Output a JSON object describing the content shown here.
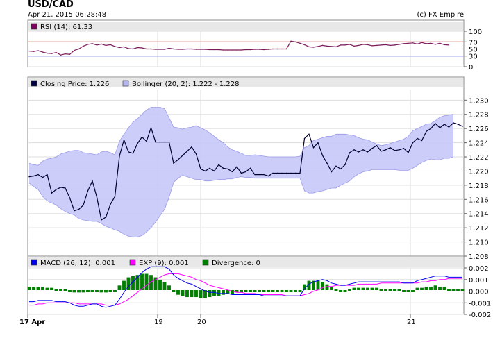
{
  "header": {
    "symbol": "USD/CAD",
    "timestamp": "Apr 21, 2015 06:28:48",
    "copyright": "(c) FX Empire"
  },
  "colors": {
    "price": "#000033",
    "bollinger_fill": "#c8c8f8",
    "bollinger_edge": "#9a9ae8",
    "rsi": "#7a1a5a",
    "rsi_70": "#e06060",
    "rsi_30": "#6060e0",
    "macd": "#0000ee",
    "exp": "#ff00ff",
    "divergence": "#008000",
    "legend_bg": "#e8e8e8",
    "grid": "#dddddd"
  },
  "x_axis": {
    "labels": [
      "17 Apr",
      "19",
      "20",
      "21"
    ]
  },
  "chart_data": [
    {
      "type": "line",
      "panel": "rsi",
      "legend": [
        {
          "label": "RSI (14): 61.33",
          "color": "#800060"
        }
      ],
      "ylim": [
        0,
        100
      ],
      "ticks": [
        "100",
        "70",
        "50",
        "30",
        "0"
      ],
      "levels": [
        70,
        30
      ],
      "series": [
        {
          "name": "RSI (14)",
          "values": [
            44,
            43,
            45,
            41,
            38,
            37,
            40,
            33,
            36,
            35,
            46,
            50,
            58,
            63,
            65,
            61,
            64,
            60,
            62,
            57,
            54,
            56,
            51,
            50,
            54,
            53,
            50,
            50,
            49,
            49,
            49,
            52,
            50,
            49,
            49,
            50,
            50,
            49,
            49,
            49,
            48,
            48,
            48,
            47,
            47,
            47,
            47,
            47,
            48,
            48,
            49,
            49,
            48,
            49,
            50,
            50,
            50,
            50,
            72,
            70,
            66,
            62,
            56,
            55,
            57,
            60,
            58,
            57,
            56,
            61,
            61,
            63,
            58,
            60,
            63,
            62,
            59,
            60,
            61,
            62,
            60,
            61,
            63,
            65,
            66,
            67,
            64,
            68,
            65,
            66,
            63,
            66,
            62,
            61
          ]
        }
      ]
    },
    {
      "type": "line",
      "panel": "price",
      "legend": [
        {
          "label": "Closing Price: 1.226",
          "color": "#000040"
        },
        {
          "label": "Bollinger (20, 2): 1.222 - 1.228",
          "color": "#b4b4f0"
        }
      ],
      "ylim": [
        1.208,
        1.2315
      ],
      "ticks": [
        "1.230",
        "1.228",
        "1.226",
        "1.224",
        "1.222",
        "1.220",
        "1.218",
        "1.216",
        "1.214",
        "1.212",
        "1.210",
        "1.208"
      ],
      "series": [
        {
          "name": "Closing Price",
          "values": [
            1.2192,
            1.2193,
            1.2195,
            1.2191,
            1.2195,
            1.2169,
            1.2174,
            1.2177,
            1.2176,
            1.2162,
            1.2144,
            1.2146,
            1.2152,
            1.2172,
            1.2186,
            1.2163,
            1.2131,
            1.2135,
            1.2153,
            1.2164,
            1.2221,
            1.2244,
            1.2227,
            1.2225,
            1.2239,
            1.2248,
            1.2242,
            1.2261,
            1.2241,
            1.2241,
            1.2241,
            1.2241,
            1.2211,
            1.2216,
            1.2222,
            1.2228,
            1.2234,
            1.2224,
            1.2203,
            1.22,
            1.2204,
            1.22,
            1.2209,
            1.2204,
            1.2203,
            1.2199,
            1.2206,
            1.2197,
            1.2199,
            1.2204,
            1.2195,
            1.2195,
            1.2195,
            1.2193,
            1.2197,
            1.2197,
            1.2197,
            1.2197,
            1.2197,
            1.2197,
            1.2197,
            1.2246,
            1.2252,
            1.2233,
            1.224,
            1.2222,
            1.2211,
            1.2199,
            1.2207,
            1.2203,
            1.2209,
            1.2226,
            1.223,
            1.2227,
            1.223,
            1.2227,
            1.2232,
            1.2236,
            1.2228,
            1.223,
            1.2233,
            1.2229,
            1.223,
            1.2232,
            1.2226,
            1.224,
            1.2246,
            1.2243,
            1.2256,
            1.226,
            1.2267,
            1.2261,
            1.2266,
            1.2262,
            1.2268,
            1.2266,
            1.2263
          ]
        },
        {
          "name": "Bollinger Upper",
          "values": [
            1.2211,
            1.2209,
            1.2208,
            1.2214,
            1.2217,
            1.2218,
            1.222,
            1.2224,
            1.2226,
            1.2228,
            1.2229,
            1.2229,
            1.2226,
            1.2225,
            1.2224,
            1.2223,
            1.2227,
            1.2228,
            1.2226,
            1.2223,
            1.2242,
            1.2252,
            1.2261,
            1.2269,
            1.2274,
            1.228,
            1.2286,
            1.229,
            1.229,
            1.229,
            1.2288,
            1.2275,
            1.2262,
            1.2261,
            1.2259,
            1.2261,
            1.2262,
            1.2264,
            1.2261,
            1.2258,
            1.2254,
            1.2249,
            1.2244,
            1.224,
            1.2234,
            1.223,
            1.2228,
            1.2225,
            1.2222,
            1.2222,
            1.2223,
            1.2222,
            1.2221,
            1.222,
            1.222,
            1.222,
            1.222,
            1.222,
            1.222,
            1.222,
            1.2221,
            1.2233,
            1.2236,
            1.2243,
            1.2245,
            1.2247,
            1.2249,
            1.2249,
            1.2252,
            1.2252,
            1.2252,
            1.2251,
            1.225,
            1.2247,
            1.2245,
            1.2244,
            1.2241,
            1.2238,
            1.2236,
            1.2237,
            1.2239,
            1.2241,
            1.2243,
            1.2245,
            1.2249,
            1.2257,
            1.226,
            1.2263,
            1.2266,
            1.2267,
            1.2271,
            1.2276,
            1.2278,
            1.2279,
            1.228
          ]
        },
        {
          "name": "Bollinger Lower",
          "values": [
            1.2183,
            1.2178,
            1.2174,
            1.2164,
            1.2158,
            1.2155,
            1.2152,
            1.2147,
            1.2143,
            1.214,
            1.2138,
            1.2133,
            1.2131,
            1.213,
            1.2129,
            1.2129,
            1.2126,
            1.2122,
            1.212,
            1.2117,
            1.2115,
            1.2111,
            1.2108,
            1.2107,
            1.2107,
            1.2109,
            1.2114,
            1.212,
            1.2128,
            1.2137,
            1.2146,
            1.2163,
            1.2184,
            1.219,
            1.2194,
            1.2192,
            1.219,
            1.2188,
            1.2188,
            1.2186,
            1.2186,
            1.2187,
            1.2188,
            1.2188,
            1.2189,
            1.2189,
            1.2191,
            1.2192,
            1.2191,
            1.2191,
            1.219,
            1.219,
            1.219,
            1.219,
            1.219,
            1.219,
            1.219,
            1.219,
            1.219,
            1.219,
            1.219,
            1.2172,
            1.2169,
            1.2169,
            1.2171,
            1.2172,
            1.2174,
            1.2176,
            1.2176,
            1.218,
            1.2183,
            1.2186,
            1.2192,
            1.2196,
            1.2199,
            1.22,
            1.2202,
            1.2202,
            1.2202,
            1.2202,
            1.2202,
            1.2202,
            1.2201,
            1.2201,
            1.2201,
            1.2204,
            1.2208,
            1.2212,
            1.2215,
            1.2217,
            1.2216,
            1.2216,
            1.2218,
            1.2218,
            1.222
          ]
        }
      ]
    },
    {
      "type": "bar",
      "panel": "macd",
      "legend": [
        {
          "label": "MACD (26, 12): 0.001",
          "color": "#0000ee"
        },
        {
          "label": "EXP (9): 0.001",
          "color": "#ff00ff"
        },
        {
          "label": "Divergence: 0",
          "color": "#008000"
        }
      ],
      "ylim": [
        -0.002,
        0.002
      ],
      "ticks": [
        "0.002",
        "0.001",
        "0.000",
        "-0.001",
        "-0.002"
      ],
      "series": [
        {
          "name": "MACD",
          "values": [
            -0.0009,
            -0.0009,
            -0.0008,
            -0.0008,
            -0.0008,
            -0.0008,
            -0.0009,
            -0.0009,
            -0.0009,
            -0.001,
            -0.0012,
            -0.0013,
            -0.0013,
            -0.0012,
            -0.0011,
            -0.0011,
            -0.0013,
            -0.0014,
            -0.0013,
            -0.0012,
            -0.0007,
            -0.0001,
            0.0004,
            0.0008,
            0.0012,
            0.0016,
            0.0019,
            0.0021,
            0.0021,
            0.0021,
            0.0021,
            0.0019,
            0.0014,
            0.0011,
            0.0009,
            0.0007,
            0.0006,
            0.0004,
            0.0002,
            0.0,
            -0.0001,
            -0.0001,
            -0.0002,
            -0.0002,
            -0.0002,
            -0.0003,
            -0.0003,
            -0.0003,
            -0.0003,
            -0.0003,
            -0.0003,
            -0.0003,
            -0.0004,
            -0.0004,
            -0.0004,
            -0.0004,
            -0.0004,
            -0.0004,
            -0.0004,
            -0.0004,
            -0.0004,
            0.0002,
            0.0006,
            0.0008,
            0.0009,
            0.001,
            0.0009,
            0.0007,
            0.0006,
            0.0005,
            0.0005,
            0.0006,
            0.0007,
            0.0008,
            0.0008,
            0.0008,
            0.0008,
            0.0008,
            0.0008,
            0.0008,
            0.0008,
            0.0008,
            0.0008,
            0.0007,
            0.0007,
            0.0007,
            0.0009,
            0.001,
            0.0011,
            0.0012,
            0.0013,
            0.0013,
            0.0013,
            0.0012,
            0.0012,
            0.0012,
            0.0012
          ]
        },
        {
          "name": "EXP",
          "values": [
            -0.0012,
            -0.0012,
            -0.0011,
            -0.0011,
            -0.001,
            -0.001,
            -0.001,
            -0.001,
            -0.001,
            -0.001,
            -0.001,
            -0.0011,
            -0.0011,
            -0.0011,
            -0.0011,
            -0.0011,
            -0.0011,
            -0.0012,
            -0.0012,
            -0.0012,
            -0.0011,
            -0.0009,
            -0.0007,
            -0.0004,
            -0.0001,
            0.0002,
            0.0005,
            0.0008,
            0.001,
            0.0012,
            0.0014,
            0.0015,
            0.0015,
            0.0015,
            0.0014,
            0.0013,
            0.0012,
            0.001,
            0.0009,
            0.0007,
            0.0005,
            0.0004,
            0.0003,
            0.0002,
            0.0001,
            0.0,
            -0.0001,
            -0.0001,
            -0.0002,
            -0.0002,
            -0.0002,
            -0.0003,
            -0.0003,
            -0.0003,
            -0.0003,
            -0.0003,
            -0.0003,
            -0.0004,
            -0.0004,
            -0.0004,
            -0.0004,
            -0.0003,
            -0.0002,
            0.0,
            0.0001,
            0.0003,
            0.0004,
            0.0004,
            0.0005,
            0.0005,
            0.0005,
            0.0005,
            0.0005,
            0.0006,
            0.0006,
            0.0006,
            0.0006,
            0.0006,
            0.0007,
            0.0007,
            0.0007,
            0.0007,
            0.0007,
            0.0007,
            0.0007,
            0.0007,
            0.0007,
            0.0008,
            0.0008,
            0.0009,
            0.0009,
            0.001,
            0.001,
            0.0011,
            0.0011,
            0.0011,
            0.0011
          ]
        },
        {
          "name": "Divergence",
          "values": [
            0.0003,
            0.0003,
            0.0003,
            0.0003,
            0.0002,
            0.0002,
            0.0001,
            0.0001,
            0.0001,
            0.0,
            -0.0002,
            -0.0002,
            -0.0002,
            -0.0001,
            0.0,
            0.0,
            -0.0002,
            -0.0002,
            -0.0001,
            0.0,
            0.0004,
            0.0008,
            0.0011,
            0.0012,
            0.0013,
            0.0014,
            0.0014,
            0.0013,
            0.0011,
            0.0009,
            0.0007,
            0.0004,
            -0.0001,
            -0.0004,
            -0.0005,
            -0.0006,
            -0.0006,
            -0.0006,
            -0.0007,
            -0.0007,
            -0.0006,
            -0.0005,
            -0.0005,
            -0.0004,
            -0.0003,
            -0.0003,
            -0.0002,
            -0.0002,
            -0.0001,
            -0.0001,
            -0.0001,
            0.0,
            -0.0001,
            -0.0001,
            -0.0001,
            -0.0001,
            -0.0001,
            0.0,
            0.0,
            0.0,
            0.0,
            0.0005,
            0.0008,
            0.0008,
            0.0008,
            0.0007,
            0.0005,
            0.0003,
            0.0001,
            0.0,
            0.0,
            0.0001,
            0.0002,
            0.0002,
            0.0002,
            0.0002,
            0.0002,
            0.0002,
            0.0001,
            0.0001,
            0.0001,
            0.0001,
            0.0001,
            0.0,
            0.0,
            0.0,
            0.0002,
            0.0002,
            0.0003,
            0.0003,
            0.0004,
            0.0003,
            0.0003,
            0.0001,
            0.0001,
            0.0001,
            0.0001
          ]
        }
      ]
    }
  ]
}
